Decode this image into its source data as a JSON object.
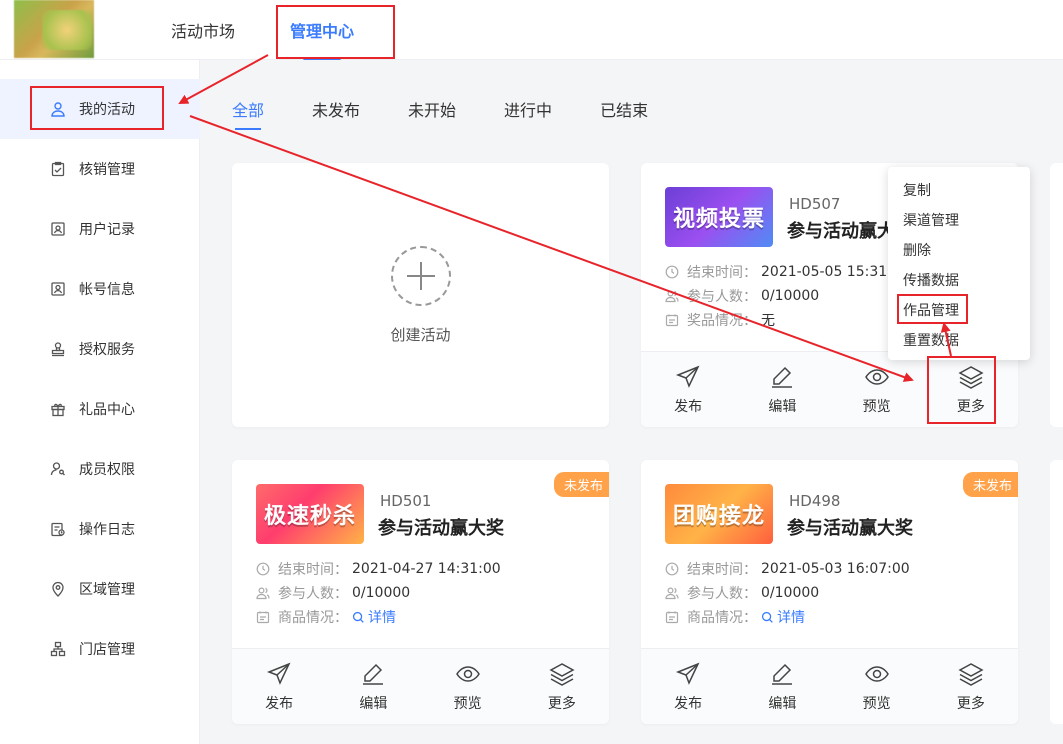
{
  "top_nav": {
    "market": "活动市场",
    "manage": "管理中心"
  },
  "sidebar": {
    "items": [
      {
        "label": "我的活动",
        "icon": "user-icon"
      },
      {
        "label": "核销管理",
        "icon": "clipboard-check-icon"
      },
      {
        "label": "用户记录",
        "icon": "id-card-icon"
      },
      {
        "label": "帐号信息",
        "icon": "account-icon"
      },
      {
        "label": "授权服务",
        "icon": "stamp-icon"
      },
      {
        "label": "礼品中心",
        "icon": "gift-icon"
      },
      {
        "label": "成员权限",
        "icon": "member-key-icon"
      },
      {
        "label": "操作日志",
        "icon": "log-icon"
      },
      {
        "label": "区域管理",
        "icon": "location-icon"
      },
      {
        "label": "门店管理",
        "icon": "org-chart-icon"
      }
    ]
  },
  "tabs": [
    "全部",
    "未发布",
    "未开始",
    "进行中",
    "已结束"
  ],
  "create": {
    "label": "创建活动"
  },
  "cards": [
    {
      "code": "HD507",
      "title": "参与活动赢大",
      "thumb_text": "视频投票",
      "end_label": "结束时间：",
      "end_value": "2021-05-05 15:31:0",
      "people_label": "参与人数：",
      "people_value": "0/10000",
      "prize_label": "奖品情况：",
      "prize_value": "无"
    },
    {
      "code": "HD501",
      "title": "参与活动赢大奖",
      "thumb_text": "极速秒杀",
      "badge": "未发布",
      "end_label": "结束时间：",
      "end_value": "2021-04-27 14:31:00",
      "people_label": "参与人数：",
      "people_value": "0/10000",
      "prize_label": "商品情况：",
      "prize_link": "详情"
    },
    {
      "code": "HD498",
      "title": "参与活动赢大奖",
      "thumb_text": "团购接龙",
      "badge": "未发布",
      "end_label": "结束时间：",
      "end_value": "2021-05-03 16:07:00",
      "people_label": "参与人数：",
      "people_value": "0/10000",
      "prize_label": "商品情况：",
      "prize_link": "详情"
    }
  ],
  "actions": {
    "publish": "发布",
    "edit": "编辑",
    "preview": "预览",
    "more": "更多"
  },
  "dropdown": [
    "复制",
    "渠道管理",
    "删除",
    "传播数据",
    "作品管理",
    "重置数据"
  ],
  "colors": {
    "accent": "#3b7cff",
    "badge": "#ffa24a",
    "annotation": "#e8242b"
  }
}
